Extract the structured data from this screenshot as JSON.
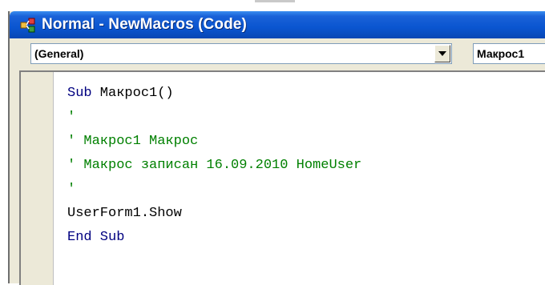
{
  "window": {
    "title": "Normal - NewMacros (Code)"
  },
  "toolbar": {
    "object_combo": "(General)",
    "procedure_combo": "Макрос1"
  },
  "code": {
    "line1_kw": "Sub",
    "line1_rest": " Макрос1()",
    "line2": "'",
    "line3": "' Макрос1 Макрос",
    "line4": "' Макрос записан 16.09.2010 HomeUser",
    "line5": "'",
    "line6": "UserForm1.Show",
    "line7": "End Sub"
  },
  "colors": {
    "keyword": "#000080",
    "comment": "#008000",
    "titlebar": "#0a55d0"
  }
}
